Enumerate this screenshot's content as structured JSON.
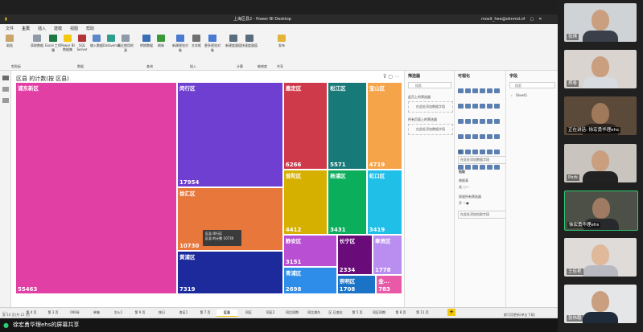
{
  "window": {
    "title": "上海区县2 - Power BI Desktop",
    "user": "mosit_hee@oknmd.cf"
  },
  "ribbon": {
    "tabs": [
      "文件",
      "主页",
      "插入",
      "建模",
      "视图",
      "帮助"
    ],
    "active_tab": "主页",
    "buttons": [
      "粘贴",
      "获取数据",
      "Excel 工作簿",
      "Power BI 数据集",
      "SQL Server",
      "输入数据",
      "Dataverse",
      "最近使用的源",
      "转换数据",
      "刷新",
      "新建视觉对象",
      "文本框",
      "更多视觉对象",
      "新建度量值",
      "快速度量值",
      "发布"
    ],
    "groups": [
      "剪贴板",
      "数据",
      "查询",
      "插入",
      "计算",
      "敏感度",
      "共享"
    ]
  },
  "visual": {
    "title": "区县 的计数(按 区县)",
    "tooltip_line1": "区县   闵行区",
    "tooltip_line2": "区县 的计数   10730"
  },
  "chart_data": {
    "type": "treemap",
    "title": "区县 的计数(按 区县)",
    "categories": [
      "浦东新区",
      "闵行区",
      "徐汇区",
      "黄浦区",
      "嘉定区",
      "松江区",
      "宝山区",
      "普陀区",
      "杨浦区",
      "虹口区",
      "静安区",
      "长宁区",
      "奉贤区",
      "青浦区",
      "崇明区",
      "金山区"
    ],
    "values": [
      55463,
      17954,
      10730,
      7319,
      6266,
      5571,
      4719,
      4412,
      3431,
      3419,
      3151,
      2334,
      1778,
      2698,
      1708,
      783
    ],
    "labels": [
      "55463",
      "17954",
      "10730",
      "7319",
      "6266",
      "5571",
      "4719",
      "4412",
      "3431",
      "3419",
      "3151",
      "2334",
      "1778",
      "2698",
      "1708",
      "783"
    ],
    "display_names": [
      "浦东新区",
      "闵行区",
      "徐汇区",
      "黄浦区",
      "嘉定区",
      "松江区",
      "宝山区",
      "普陀区",
      "杨浦区",
      "虹口区",
      "静安区",
      "长宁区",
      "奉贤区",
      "青浦区",
      "崇明区",
      "金..."
    ],
    "colors": [
      "#e23fa5",
      "#6f3fd1",
      "#e8773b",
      "#1c2a9c",
      "#cf3a4a",
      "#187a78",
      "#f5a44a",
      "#d6b000",
      "#0aae5b",
      "#1fbfe8",
      "#b94fd3",
      "#6a0b7a",
      "#b98ef0",
      "#2e8de8",
      "#1a73c7",
      "#e85aa8"
    ]
  },
  "filters_pane": {
    "title": "筛选器",
    "search_placeholder": "搜索",
    "section1": "此页上的筛选器",
    "drop1": "在此处添加数据字段",
    "section2": "所有页面上的筛选器",
    "drop2": "在此处添加数据字段"
  },
  "viz_pane": {
    "title": "可视化",
    "values_label": "值",
    "values_drop": "在此处添加数据字段",
    "drill_label": "钻取",
    "cross_report": "跨报表",
    "cross_off": "关 ○—",
    "keep_filters": "保留所有筛选器",
    "keep_on": "开 —●",
    "drill_drop": "在此处添加钻取字段"
  },
  "fields_pane": {
    "title": "字段",
    "search_placeholder": "搜索",
    "table": "Sheet1"
  },
  "page_tabs": [
    "第 4 页",
    "第 3 页",
    "000母",
    "单轴",
    "交火1",
    "第 9 页",
    "按日",
    "各区1",
    "第 7 页",
    "区县",
    "同区",
    "同区2",
    "同比同期",
    "同比浦东",
    "区 日变化",
    "第 5 页",
    "同区同期",
    "第 8 页",
    "第 11 页"
  ],
  "active_page_tab": "区县",
  "status": {
    "left": "第 10 页(共 21 页)",
    "right": "都可用更新(单击下载)"
  },
  "participants": [
    {
      "name": "张琪",
      "speaking": false
    },
    {
      "name": "郑卷",
      "speaking": false
    },
    {
      "name": "正在讲话: 徐宏勇华理ehs",
      "speaking": true
    },
    {
      "name": "Pork",
      "speaking": false
    },
    {
      "name": "徐宏勇华理ehs",
      "speaking": false
    },
    {
      "name": "王佳艳",
      "speaking": false
    },
    {
      "name": "张伟毅",
      "speaking": false
    }
  ],
  "share_banner": "徐宏勇华理ehs的屏幕共享"
}
